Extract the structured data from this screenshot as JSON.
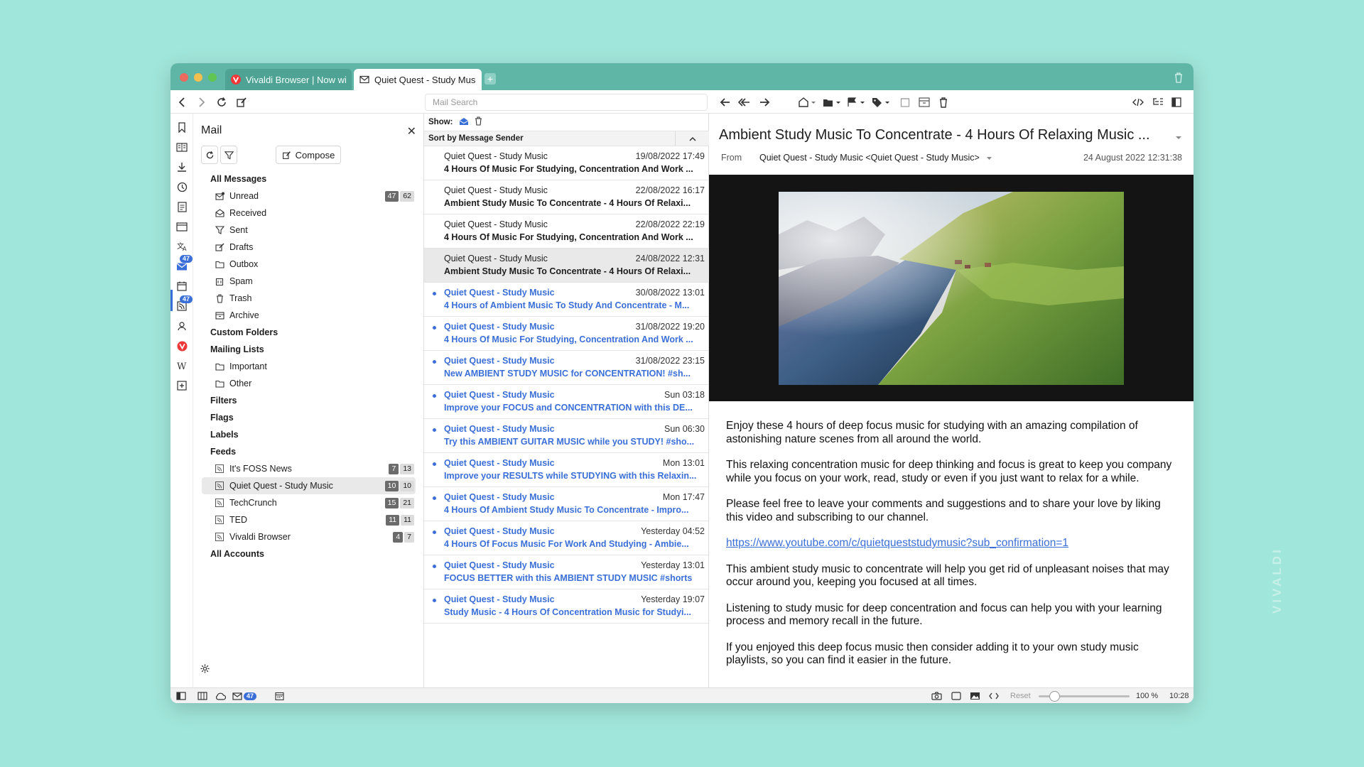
{
  "tabs": [
    {
      "title": "Vivaldi Browser | Now with",
      "active": false
    },
    {
      "title": "Quiet Quest - Study Music",
      "active": true
    }
  ],
  "toolbar": {
    "search_placeholder": "Mail Search"
  },
  "rail": {
    "mail_badge": "47",
    "feeds_badge": "47"
  },
  "mail_panel": {
    "title": "Mail",
    "compose_label": "Compose",
    "all_messages": "All Messages",
    "system_folders": [
      {
        "label": "Unread",
        "icon": "unread-envelope-icon",
        "unread": "47",
        "total": "62"
      },
      {
        "label": "Received",
        "icon": "received-icon"
      },
      {
        "label": "Sent",
        "icon": "sent-icon"
      },
      {
        "label": "Drafts",
        "icon": "drafts-icon"
      },
      {
        "label": "Outbox",
        "icon": "folder-icon"
      },
      {
        "label": "Spam",
        "icon": "spam-icon"
      },
      {
        "label": "Trash",
        "icon": "trash-icon"
      },
      {
        "label": "Archive",
        "icon": "archive-icon"
      }
    ],
    "custom_folders": "Custom Folders",
    "mailing_lists": "Mailing Lists",
    "mailing_list_items": [
      {
        "label": "Important",
        "icon": "folder-icon"
      },
      {
        "label": "Other",
        "icon": "folder-icon"
      }
    ],
    "filters": "Filters",
    "flags": "Flags",
    "labels": "Labels",
    "feeds": "Feeds",
    "feed_items": [
      {
        "label": "It's FOSS News",
        "unread": "7",
        "total": "13"
      },
      {
        "label": "Quiet Quest - Study Music",
        "unread": "10",
        "total": "10",
        "selected": true
      },
      {
        "label": "TechCrunch",
        "unread": "15",
        "total": "21"
      },
      {
        "label": "TED",
        "unread": "11",
        "total": "11"
      },
      {
        "label": "Vivaldi Browser",
        "unread": "4",
        "total": "7"
      }
    ],
    "all_accounts": "All Accounts"
  },
  "message_list": {
    "show_label": "Show:",
    "sort_label": "Sort by Message Sender",
    "messages": [
      {
        "sender": "Quiet Quest - Study Music",
        "date": "19/08/2022 17:49",
        "subject": "4 Hours Of Music For Studying, Concentration And Work ...",
        "unread": false
      },
      {
        "sender": "Quiet Quest - Study Music",
        "date": "22/08/2022 16:17",
        "subject": "Ambient Study Music To Concentrate - 4 Hours Of Relaxi...",
        "unread": false
      },
      {
        "sender": "Quiet Quest - Study Music",
        "date": "22/08/2022 22:19",
        "subject": "4 Hours Of Music For Studying, Concentration And Work ...",
        "unread": false
      },
      {
        "sender": "Quiet Quest - Study Music",
        "date": "24/08/2022 12:31",
        "subject": "Ambient Study Music To Concentrate - 4 Hours Of Relaxi...",
        "unread": false,
        "selected": true
      },
      {
        "sender": "Quiet Quest - Study Music",
        "date": "30/08/2022 13:01",
        "subject": "4 Hours of Ambient Music To Study And Concentrate - M...",
        "unread": true
      },
      {
        "sender": "Quiet Quest - Study Music",
        "date": "31/08/2022 19:20",
        "subject": "4 Hours Of Music For Studying, Concentration And Work ...",
        "unread": true
      },
      {
        "sender": "Quiet Quest - Study Music",
        "date": "31/08/2022 23:15",
        "subject": "New AMBIENT STUDY MUSIC for CONCENTRATION! #sh...",
        "unread": true
      },
      {
        "sender": "Quiet Quest - Study Music",
        "date": "Sun 03:18",
        "subject": "Improve your FOCUS and CONCENTRATION with this DE...",
        "unread": true
      },
      {
        "sender": "Quiet Quest - Study Music",
        "date": "Sun 06:30",
        "subject": "Try this AMBIENT GUITAR MUSIC while you STUDY! #sho...",
        "unread": true
      },
      {
        "sender": "Quiet Quest - Study Music",
        "date": "Mon 13:01",
        "subject": "Improve your RESULTS while STUDYING with this Relaxin...",
        "unread": true
      },
      {
        "sender": "Quiet Quest - Study Music",
        "date": "Mon 17:47",
        "subject": "4 Hours Of Ambient Study Music To Concentrate - Impro...",
        "unread": true
      },
      {
        "sender": "Quiet Quest - Study Music",
        "date": "Yesterday 04:52",
        "subject": "4 Hours Of Focus Music For Work And Studying - Ambie...",
        "unread": true
      },
      {
        "sender": "Quiet Quest - Study Music",
        "date": "Yesterday 13:01",
        "subject": "FOCUS BETTER with this AMBIENT STUDY MUSIC #shorts",
        "unread": true
      },
      {
        "sender": "Quiet Quest - Study Music",
        "date": "Yesterday 19:07",
        "subject": "Study Music - 4 Hours Of Concentration Music for Studyi...",
        "unread": true
      }
    ]
  },
  "reader": {
    "subject": "Ambient Study Music To Concentrate - 4 Hours Of Relaxing Music ...",
    "from_label": "From",
    "from": "Quiet Quest - Study Music <Quiet Quest - Study Music>",
    "date": "24 August 2022 12:31:38",
    "body": [
      "Enjoy these 4 hours of deep focus music for studying with an amazing compilation of astonishing nature scenes from all around the world.",
      "This relaxing concentration music for deep thinking and focus is great to keep you company while you focus on your work, read, study or even if you just want to relax for a while.",
      "Please feel free to leave your comments and suggestions and to share your love by liking this video and subscribing to our channel."
    ],
    "link": "https://www.youtube.com/c/quietqueststudymusic?sub_confirmation=1",
    "body2": [
      "This ambient study music to concentrate will help you get rid of unpleasant noises that may occur around you, keeping you focused at all times.",
      "Listening to study music for deep concentration and focus can help you with your learning process and memory recall in the future.",
      "If you enjoyed this deep focus music then consider adding it to your own study music playlists, so you can find it easier in the future."
    ]
  },
  "statusbar": {
    "reset_label": "Reset",
    "zoom": "100 %",
    "zoom_fraction": 0.17,
    "clock": "10:28",
    "mail_badge": "47"
  },
  "watermark": "VIVALDI",
  "colors": {
    "background": "#a1e6da",
    "tabbar": "#5fb5a6",
    "accent": "#3b6fd8"
  }
}
